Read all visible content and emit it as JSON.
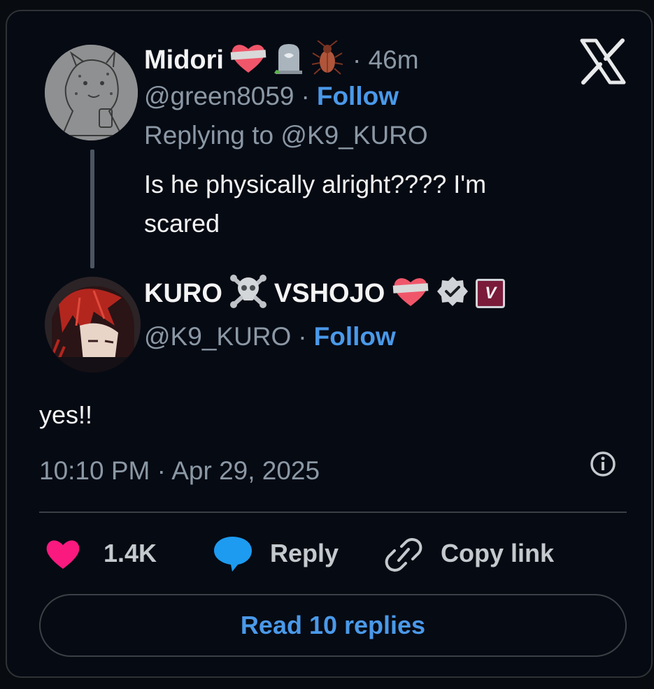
{
  "parent_tweet": {
    "display_name": "Midori",
    "time_ago": "· 46m",
    "handle": "@green8059",
    "follow_sep": "·",
    "follow_label": "Follow",
    "replying_to": "Replying to @K9_KURO",
    "text_line1": "Is he physically alright???? I'm",
    "text_line2": "scared"
  },
  "main_tweet": {
    "display_name_a": "KURO",
    "display_name_b": "VSHOJO",
    "handle": "@K9_KURO",
    "follow_sep": "·",
    "follow_label": "Follow",
    "text": "yes!!",
    "timestamp": "10:10 PM · Apr 29, 2025",
    "badge_letter": "V"
  },
  "actions": {
    "like_count": "1.4K",
    "reply_label": "Reply",
    "copy_label": "Copy link",
    "read_replies_label": "Read 10 replies"
  },
  "colors": {
    "background": "#060a13",
    "link": "#4a99e9",
    "like": "#f9197f",
    "reply": "#1d9bf0",
    "muted": "#8b98a5"
  }
}
